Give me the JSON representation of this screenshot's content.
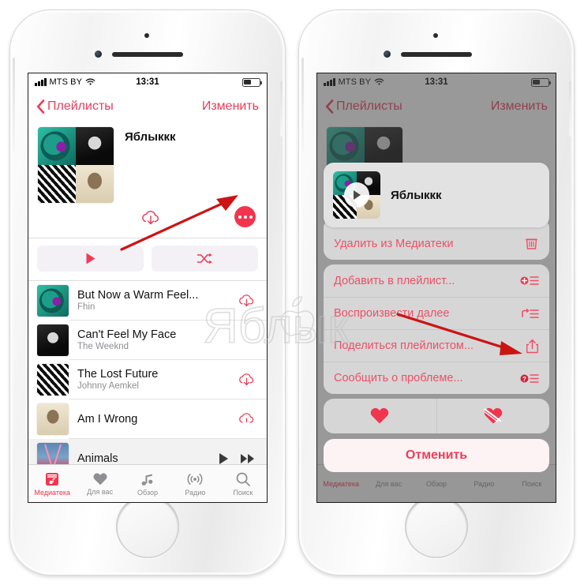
{
  "meta": {
    "accent": "#f2354f",
    "accent_soft": "#ef4f67",
    "arrow_color": "#cc1414",
    "watermark_text": "Яблык"
  },
  "statusbar": {
    "carrier": "MTS BY",
    "time": "13:31",
    "signal_icon": "signal-bars-icon",
    "wifi_icon": "wifi-icon",
    "battery_icon": "battery-icon"
  },
  "navbar": {
    "back_label": "Плейлисты",
    "back_icon": "chevron-left-icon",
    "edit_label": "Изменить"
  },
  "playlist": {
    "title": "Яблыккк",
    "download_icon": "cloud-download-icon",
    "more_icon": "more-dots-icon",
    "play_label": "play-icon",
    "shuffle_label": "shuffle-icon"
  },
  "tracks": [
    {
      "title": "But Now a Warm Feel...",
      "artist": "Fhin",
      "action_icon": "cloud-download-icon",
      "now_playing": false
    },
    {
      "title": "Can't Feel My Face",
      "artist": "The Weeknd",
      "action_icon": "",
      "now_playing": false
    },
    {
      "title": "The Lost Future",
      "artist": "Johnny Aemkel",
      "action_icon": "cloud-download-icon",
      "now_playing": false
    },
    {
      "title": "Am I Wrong",
      "artist": "",
      "action_icon": "cloud-progress-icon",
      "now_playing": false
    },
    {
      "title": "Animals",
      "artist": "",
      "action_icon": "",
      "now_playing": true
    }
  ],
  "miniplayer": {
    "play_icon": "play-icon",
    "next_icon": "fast-forward-icon"
  },
  "tabbar": {
    "items": [
      {
        "label": "Медиатека",
        "icon": "library-icon",
        "active": true
      },
      {
        "label": "Для вас",
        "icon": "heart-icon",
        "active": false
      },
      {
        "label": "Обзор",
        "icon": "note-icon",
        "active": false
      },
      {
        "label": "Радио",
        "icon": "radio-icon",
        "active": false
      },
      {
        "label": "Поиск",
        "icon": "search-icon",
        "active": false
      }
    ]
  },
  "sheet": {
    "header_title": "Яблыккк",
    "header_play_icon": "play-icon",
    "rows": [
      {
        "label": "Удалить из Медиатеки",
        "icon": "trash-icon"
      },
      {
        "label": "Добавить в плейлист...",
        "icon": "add-to-playlist-icon"
      },
      {
        "label": "Воспроизвести далее",
        "icon": "play-next-icon"
      },
      {
        "label": "Поделиться плейлистом...",
        "icon": "share-icon"
      },
      {
        "label": "Сообщить о проблеме...",
        "icon": "report-problem-icon"
      }
    ],
    "love_icon": "heart-filled-icon",
    "dislike_icon": "heart-broken-icon",
    "cancel_label": "Отменить"
  }
}
